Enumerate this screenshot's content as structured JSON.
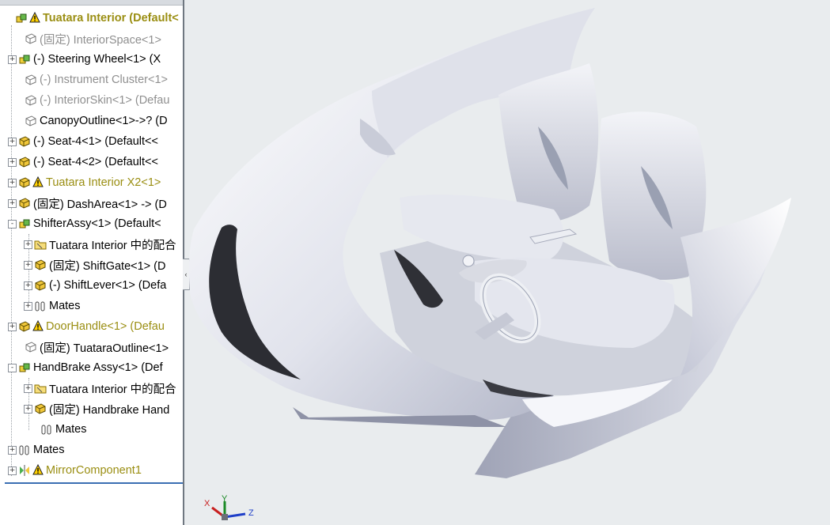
{
  "tree": {
    "items": [
      {
        "label": "Tuatara Interior  (Default<",
        "style": "warn bold",
        "icon": "assembly-icon",
        "warning": true,
        "expander": "",
        "indent": 6
      },
      {
        "label": "(固定) InteriorSpace<1>",
        "style": "gray",
        "icon": "part-gray-icon",
        "warning": false,
        "expander": "",
        "indent": 18
      },
      {
        "label": "(-) Steering Wheel<1> (X",
        "style": "",
        "icon": "subassembly-icon",
        "warning": false,
        "expander": "+",
        "indent": 10
      },
      {
        "label": "(-) Instrument Cluster<1>",
        "style": "gray",
        "icon": "part-gray-icon",
        "warning": false,
        "expander": "",
        "indent": 18
      },
      {
        "label": "(-) InteriorSkin<1> (Defau",
        "style": "gray",
        "icon": "part-gray-icon",
        "warning": false,
        "expander": "",
        "indent": 18
      },
      {
        "label": "CanopyOutline<1>->? (D",
        "style": "",
        "icon": "part-gray-icon",
        "warning": false,
        "expander": "",
        "indent": 18
      },
      {
        "label": "(-) Seat-4<1> (Default<<",
        "style": "",
        "icon": "part-yellow-icon",
        "warning": false,
        "expander": "+",
        "indent": 10
      },
      {
        "label": "(-) Seat-4<2> (Default<<",
        "style": "",
        "icon": "part-yellow-icon",
        "warning": false,
        "expander": "+",
        "indent": 10
      },
      {
        "label": "Tuatara Interior X2<1>",
        "style": "warn",
        "icon": "part-yellow-icon",
        "warning": true,
        "expander": "+",
        "indent": 10
      },
      {
        "label": "(固定) DashArea<1> -> (D",
        "style": "",
        "icon": "part-yellow-icon",
        "warning": false,
        "expander": "+",
        "indent": 10
      },
      {
        "label": "ShifterAssy<1> (Default<",
        "style": "",
        "icon": "subassembly-icon",
        "warning": false,
        "expander": "-",
        "indent": 10
      },
      {
        "label": "Tuatara Interior 中的配合",
        "style": "",
        "icon": "mates-folder-icon",
        "warning": false,
        "expander": "+",
        "indent": 30
      },
      {
        "label": "(固定) ShiftGate<1> (D",
        "style": "",
        "icon": "part-yellow-icon",
        "warning": false,
        "expander": "+",
        "indent": 30
      },
      {
        "label": "(-) ShiftLever<1> (Defa",
        "style": "",
        "icon": "part-yellow-icon",
        "warning": false,
        "expander": "+",
        "indent": 30
      },
      {
        "label": "Mates",
        "style": "",
        "icon": "mates-icon",
        "warning": false,
        "expander": "+",
        "indent": 30
      },
      {
        "label": "DoorHandle<1> (Defau",
        "style": "warn",
        "icon": "part-yellow-icon",
        "warning": true,
        "expander": "+",
        "indent": 10
      },
      {
        "label": "(固定) TuataraOutline<1>",
        "style": "",
        "icon": "part-gray-icon",
        "warning": false,
        "expander": "",
        "indent": 18
      },
      {
        "label": "HandBrake Assy<1> (Def",
        "style": "",
        "icon": "subassembly-icon",
        "warning": false,
        "expander": "-",
        "indent": 10
      },
      {
        "label": "Tuatara Interior 中的配合",
        "style": "",
        "icon": "mates-folder-icon",
        "warning": false,
        "expander": "+",
        "indent": 30
      },
      {
        "label": "(固定) Handbrake Hand",
        "style": "",
        "icon": "part-yellow-icon",
        "warning": false,
        "expander": "+",
        "indent": 30
      },
      {
        "label": "Mates",
        "style": "",
        "icon": "mates-icon",
        "warning": false,
        "expander": "",
        "indent": 38
      },
      {
        "label": "Mates",
        "style": "",
        "icon": "mates-icon",
        "warning": false,
        "expander": "+",
        "indent": 10
      },
      {
        "label": "MirrorComponent1",
        "style": "warn",
        "icon": "mirror-icon",
        "warning": true,
        "expander": "+",
        "indent": 10
      }
    ]
  },
  "triad": {
    "x": "X",
    "y": "Y",
    "z": "Z"
  },
  "colors": {
    "warning_text": "#9a8e12",
    "surface": "#d8dbe6",
    "background": "#e9ecee"
  }
}
